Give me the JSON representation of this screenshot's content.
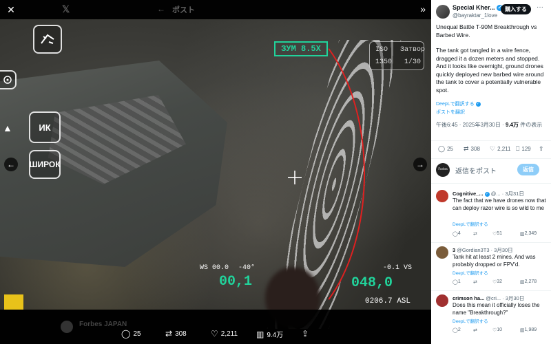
{
  "media": {
    "ghost_title": "ポスト",
    "hud": {
      "zoom": "ЗУМ 8.5X",
      "iso_label": "ISO",
      "iso_value": "1350",
      "shutter_label": "Затвор",
      "shutter_value": "1/30",
      "ik_label": "ИК",
      "wide_label": "ШИРОК",
      "ws": "WS 00.0",
      "angle": "-40°",
      "speed": "-0.1 VS",
      "green_left": "00,1",
      "green_right": "048,0",
      "asl": "0206.7 ASL"
    },
    "ghost_author": "Forbes JAPAN",
    "actions": {
      "replies": "25",
      "reposts": "308",
      "likes": "2,211",
      "views": "9.4万"
    }
  },
  "tweet": {
    "author_name": "Special Kher...",
    "handle": "@bayraktar_1love",
    "buy_label": "購入する",
    "body": [
      "Unequal Battle T-90M Breakthrough vs Barbed Wire.",
      "The tank got tangled in a wire fence, dragged it a dozen meters and stopped. And it looks like overnight, ground drones quickly deployed new barbed wire around the tank to cover a potentially vulnerable spot."
    ],
    "deepl_label": "DeepLで翻訳する",
    "translate_post": "ポストを翻訳",
    "timestamp": "午後6:45 · 2025年3月30日 · ",
    "views_count": "9.4万",
    "views_suffix": " 件の表示",
    "stats": {
      "replies": "25",
      "reposts": "308",
      "likes": "2,211",
      "bookmarks": "129"
    }
  },
  "composer": {
    "avatar_text": "Forbes",
    "placeholder": "返信をポスト",
    "reply_button": "返信"
  },
  "replies": [
    {
      "name": "Cognitive_...",
      "handle": "@...",
      "date": "3月31日",
      "text": "The fact that we have drones now that can deploy razor wire is so wild to me",
      "translate": "DeepLで翻訳する",
      "replies": "4",
      "reposts": "",
      "likes": "51",
      "views": "2,349",
      "avatar_color": "#c0392b"
    },
    {
      "name": "3",
      "handle": "@Gordian3T3",
      "date": "3月30日",
      "text": "Tank hit at least 2 mines. And was probably dropped or FPV'd.",
      "translate": "DeepLで翻訳する",
      "replies": "1",
      "reposts": "",
      "likes": "32",
      "views": "2,278",
      "avatar_color": "#7a5c3a"
    },
    {
      "name": "crimson ha...",
      "handle": "@cri...",
      "date": "3月30日",
      "text": "Does this mean it officially loses the name \"Breakthrough?\"",
      "translate": "DeepLで翻訳する",
      "replies": "2",
      "reposts": "",
      "likes": "10",
      "views": "1,989",
      "avatar_color": "#a03030"
    }
  ]
}
